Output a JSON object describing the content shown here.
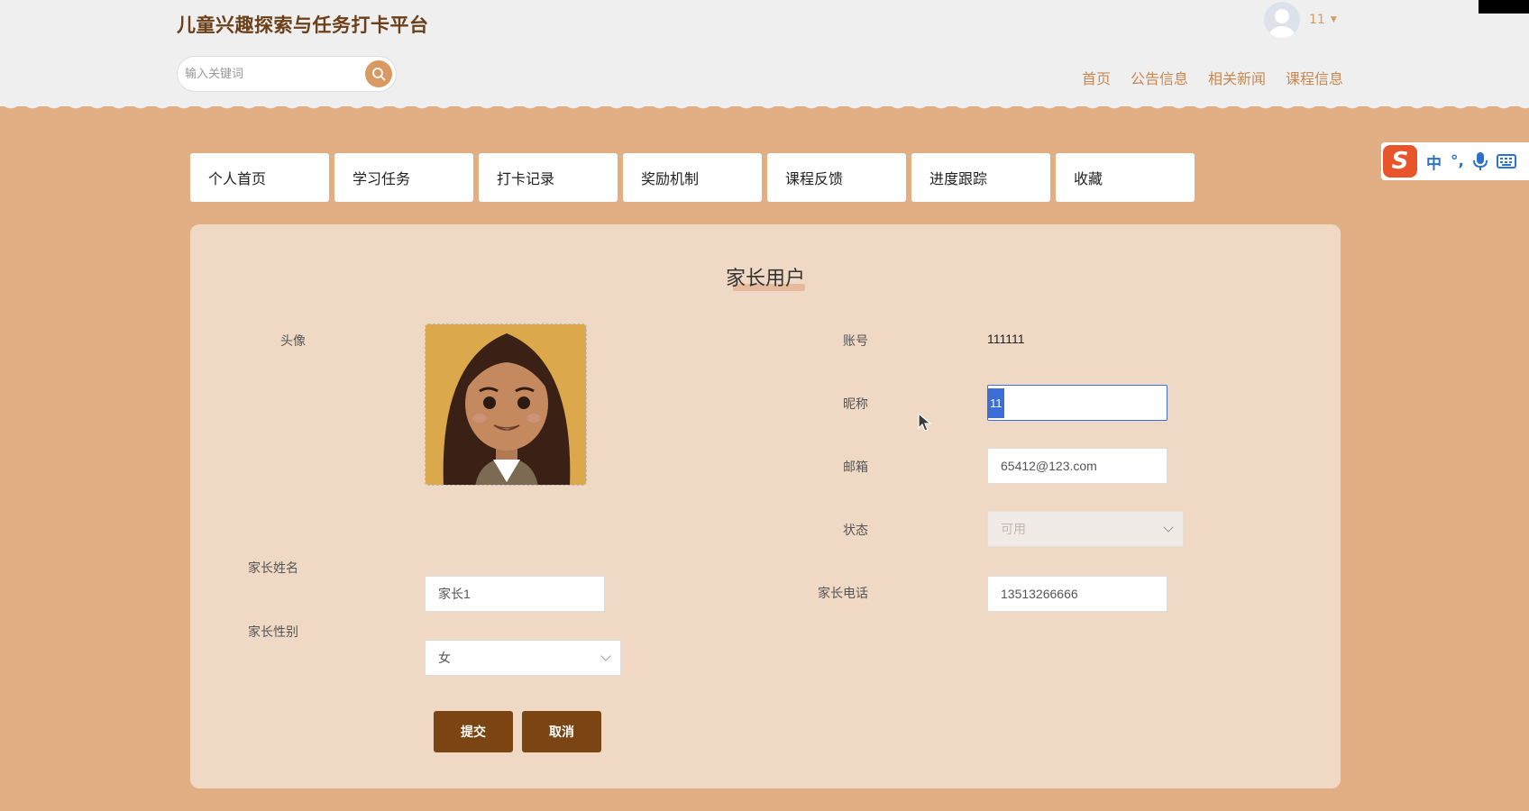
{
  "header": {
    "site_title": "儿童兴趣探索与任务打卡平台",
    "search_placeholder": "输入关键词",
    "user_name": "11",
    "nav": [
      "首页",
      "公告信息",
      "相关新闻",
      "课程信息"
    ]
  },
  "ime": {
    "logo": "S",
    "mode": "中",
    "punct": "°,"
  },
  "tabs": [
    "个人首页",
    "学习任务",
    "打卡记录",
    "奖励机制",
    "课程反馈",
    "进度跟踪",
    "收藏"
  ],
  "form": {
    "title": "家长用户",
    "avatar_label": "头像",
    "account_label": "账号",
    "account_value": "111111",
    "nickname_label": "昵称",
    "nickname_value": "11",
    "email_label": "邮箱",
    "email_value": "65412@123.com",
    "status_label": "状态",
    "status_value": "可用",
    "parent_name_label": "家长姓名",
    "parent_name_value": "家长1",
    "parent_phone_label": "家长电话",
    "parent_phone_value": "13513266666",
    "parent_gender_label": "家长性别",
    "parent_gender_value": "女",
    "submit_label": "提交",
    "cancel_label": "取消"
  },
  "colors": {
    "background": "#e2ae84",
    "header_bg": "#efefef",
    "panel_bg": "#f0d9c4",
    "title_color": "#6b3f18",
    "nav_color": "#c8884f",
    "button_bg": "#7a4512",
    "search_btn": "#d89a62"
  },
  "icons": [
    "search-icon",
    "user-avatar-icon",
    "chevron-down-icon",
    "ime-mic-icon",
    "ime-keyboard-icon",
    "mouse-cursor-icon"
  ]
}
